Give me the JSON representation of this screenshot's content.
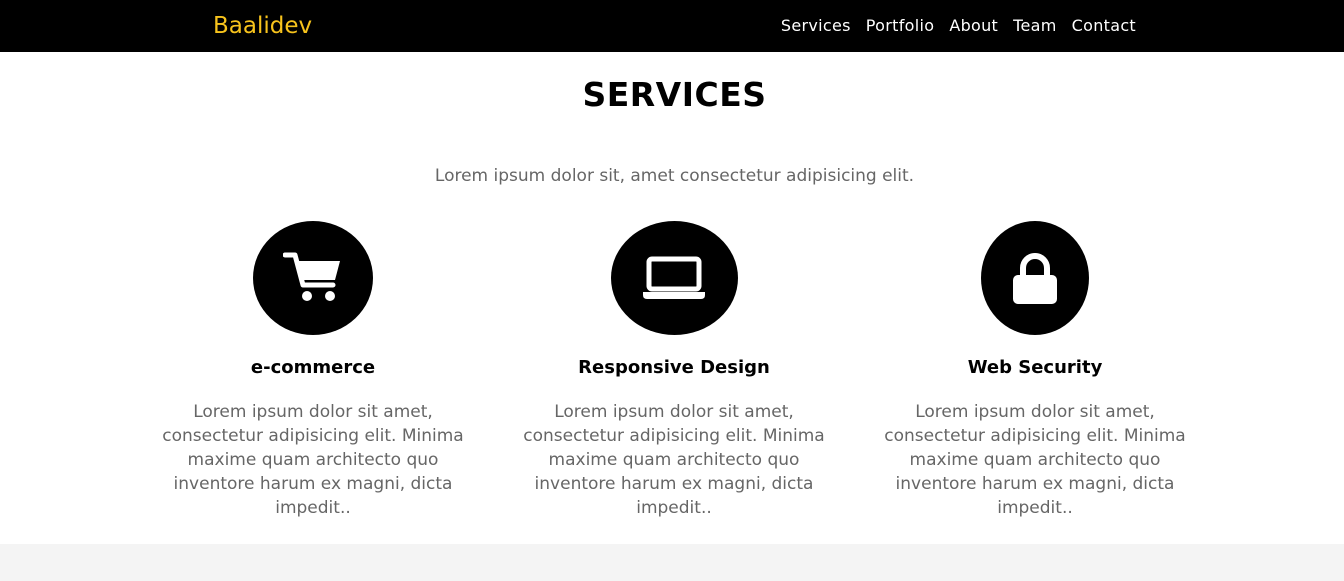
{
  "nav": {
    "brand": "Baalidev",
    "links": [
      "Services",
      "Portfolio",
      "About",
      "Team",
      "Contact"
    ]
  },
  "services": {
    "title": "SERVICES",
    "subtitle": "Lorem ipsum dolor sit, amet consectetur adipisicing elit.",
    "cards": [
      {
        "icon": "shopping-cart-icon",
        "title": "e-commerce",
        "text": "Lorem ipsum dolor sit amet, consectetur adipisicing elit. Minima maxime quam architecto quo inventore harum ex magni, dicta impedit.."
      },
      {
        "icon": "laptop-icon",
        "title": "Responsive Design",
        "text": "Lorem ipsum dolor sit amet, consectetur adipisicing elit. Minima maxime quam architecto quo inventore harum ex magni, dicta impedit.."
      },
      {
        "icon": "lock-icon",
        "title": "Web Security",
        "text": "Lorem ipsum dolor sit amet, consectetur adipisicing elit. Minima maxime quam architecto quo inventore harum ex magni, dicta impedit.."
      }
    ]
  },
  "colors": {
    "navbar_bg": "#000000",
    "brand": "#f7c31c",
    "icon_circle": "#000000",
    "body_text": "#666666",
    "footer_band": "#f4f4f4"
  }
}
